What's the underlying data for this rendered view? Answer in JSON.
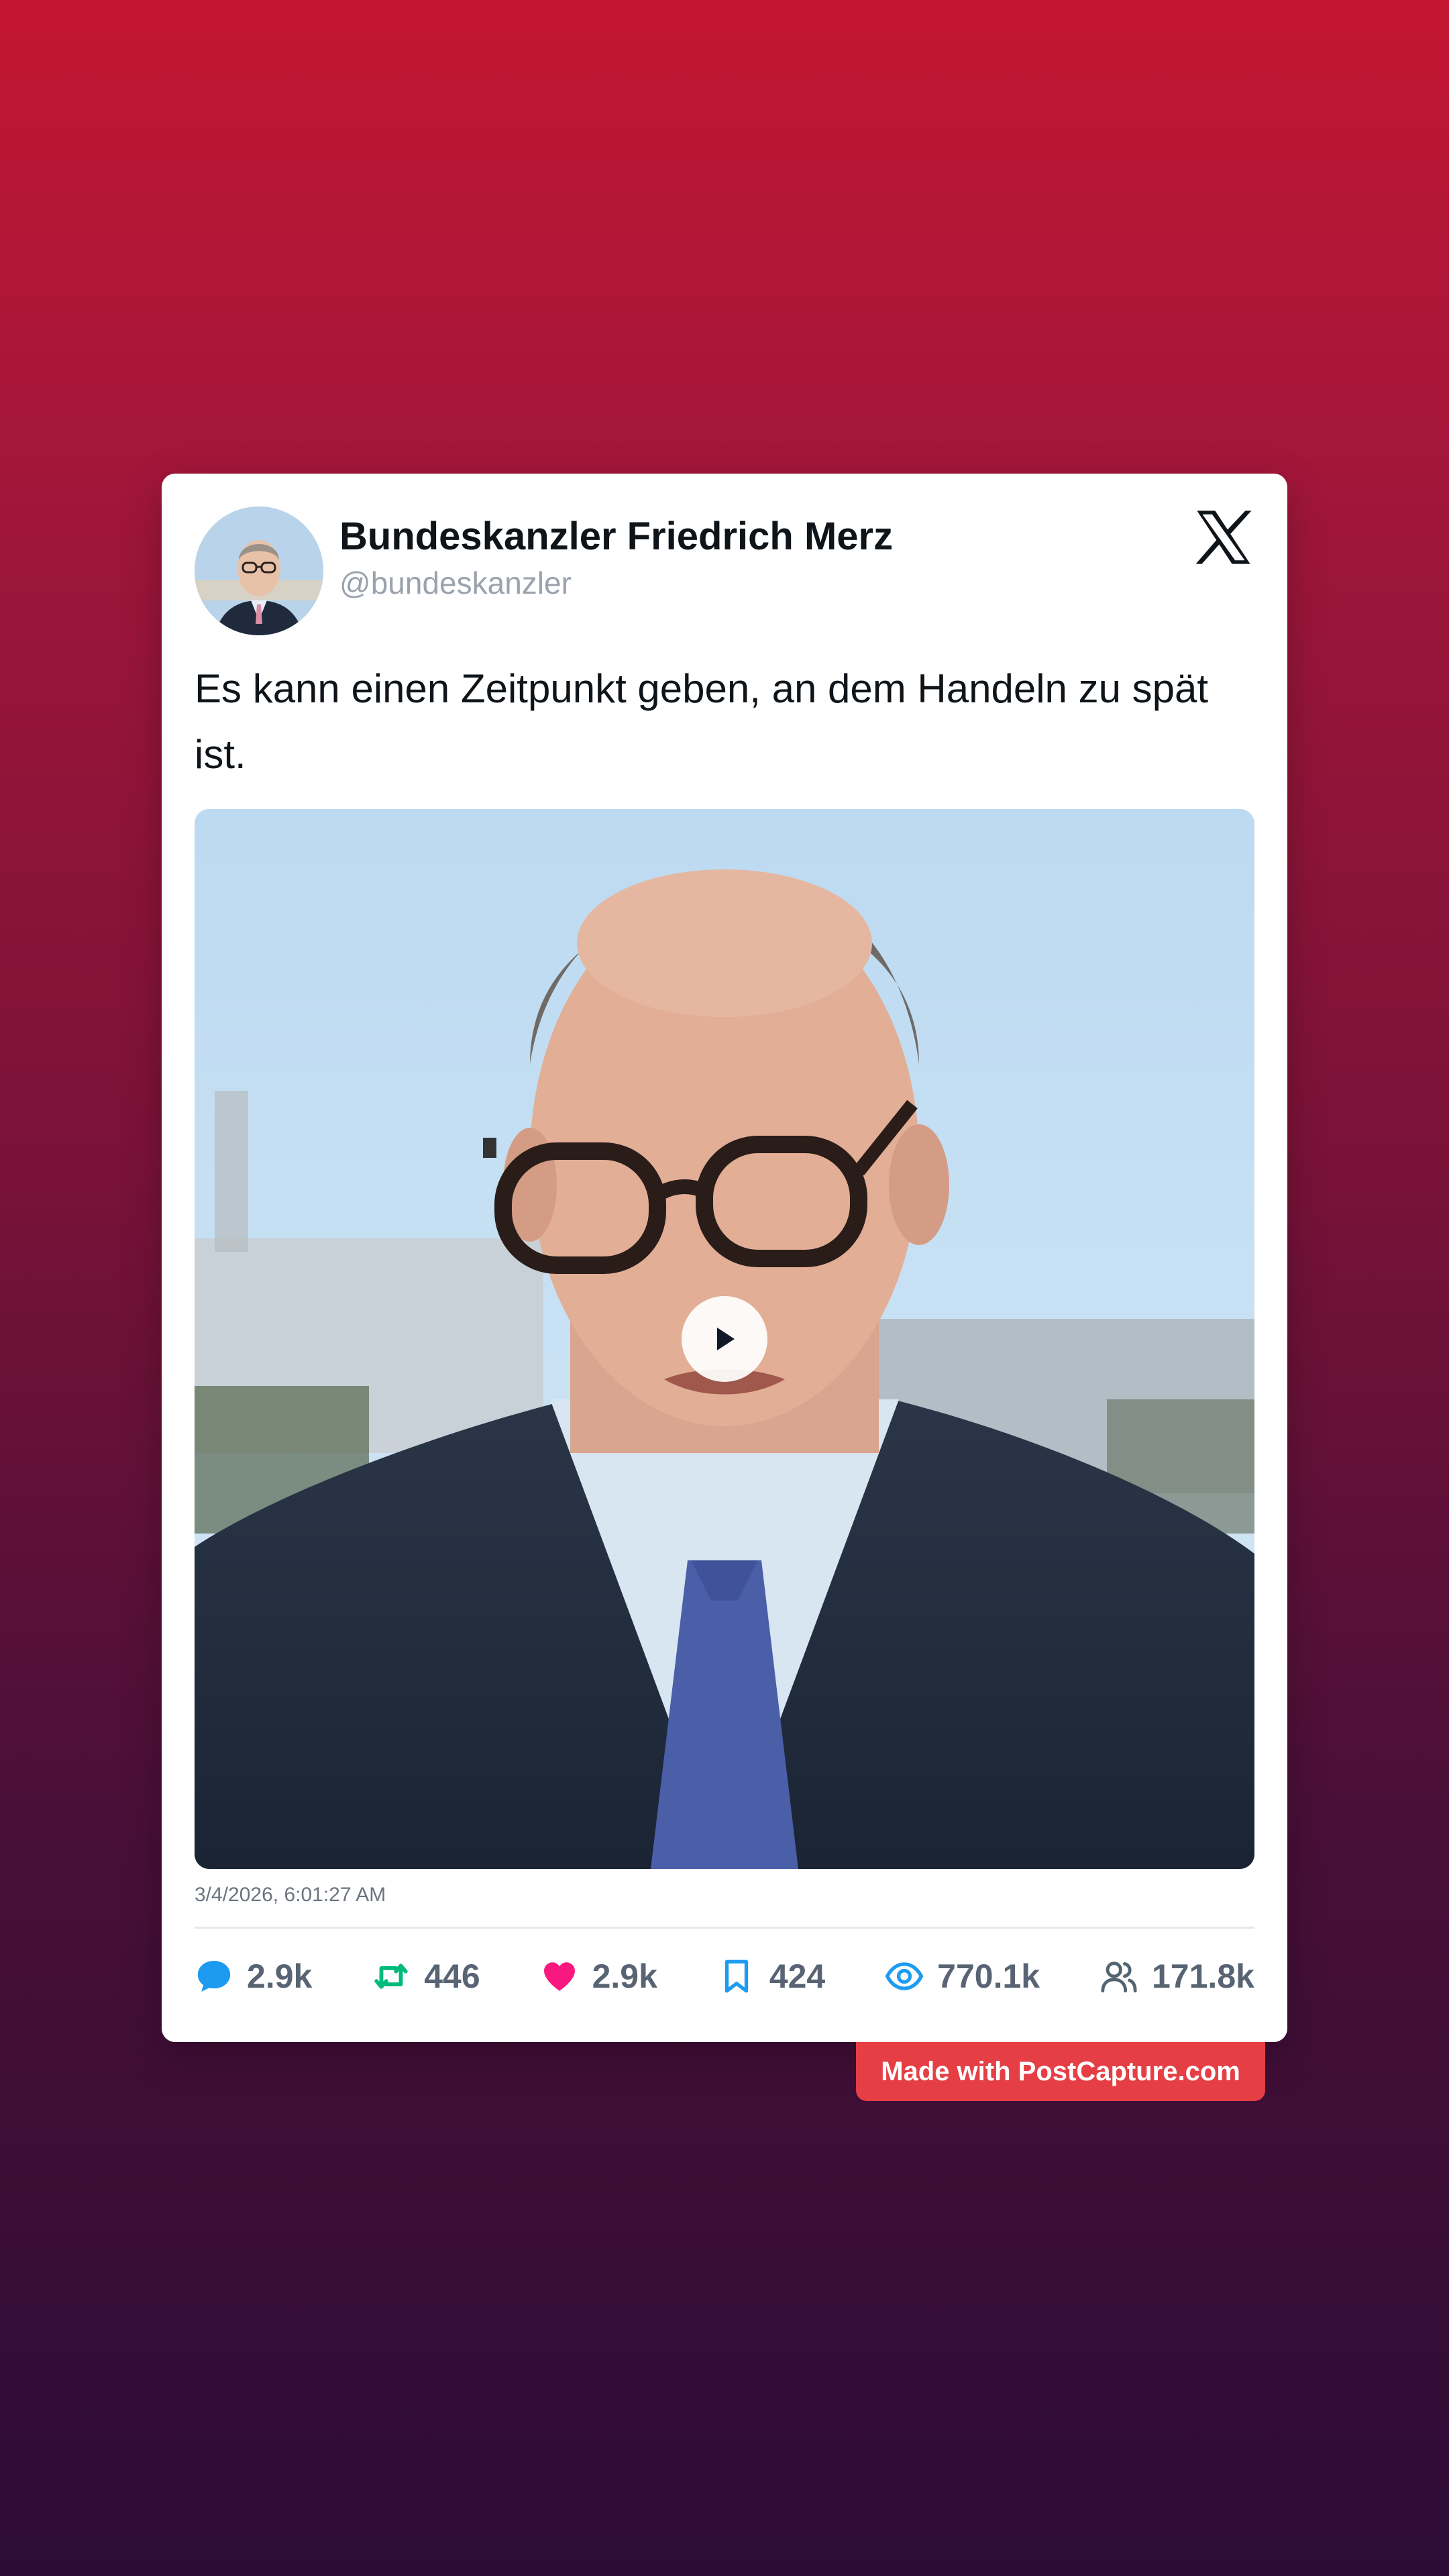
{
  "post": {
    "author_name": "Bundeskanzler Friedrich Merz",
    "author_handle": "@bundeskanzler",
    "platform_icon": "x-logo-icon",
    "text": "Es kann einen Zeitpunkt geben, an dem Handeln zu spät ist.",
    "media": {
      "type": "video",
      "play_icon": "play-icon"
    },
    "timestamp": "3/4/2026, 6:01:27 AM"
  },
  "stats": {
    "replies": "2.9k",
    "reposts": "446",
    "likes": "2.9k",
    "bookmarks": "424",
    "views": "770.1k",
    "followers": "171.8k"
  },
  "watermark": {
    "label": "Made with PostCapture.com"
  },
  "colors": {
    "reply": "#1d9bf0",
    "repost": "#00ba7c",
    "like": "#f91880",
    "bookmark": "#1d9bf0",
    "views": "#1d9bf0",
    "followers": "#536471",
    "watermark": "#e53f45"
  }
}
